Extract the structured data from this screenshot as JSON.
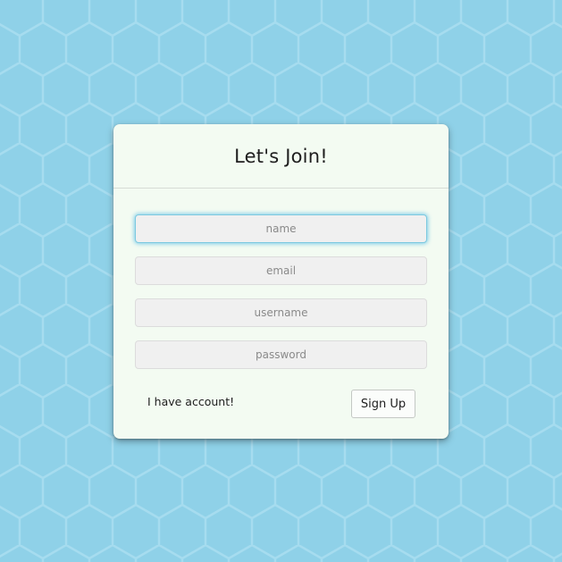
{
  "page": {
    "background_color": "#8fd1e8",
    "pattern_color": "#a6dcef"
  },
  "form": {
    "title": "Let's Join!",
    "fields": {
      "name": {
        "placeholder": "name",
        "value": ""
      },
      "email": {
        "placeholder": "email",
        "value": ""
      },
      "username": {
        "placeholder": "username",
        "value": ""
      },
      "password": {
        "placeholder": "password",
        "value": ""
      }
    },
    "have_account_link": "I have account!",
    "signup_label": "Sign Up",
    "focus_color": "#7cc9e0",
    "card_color": "#f3fbf2"
  }
}
